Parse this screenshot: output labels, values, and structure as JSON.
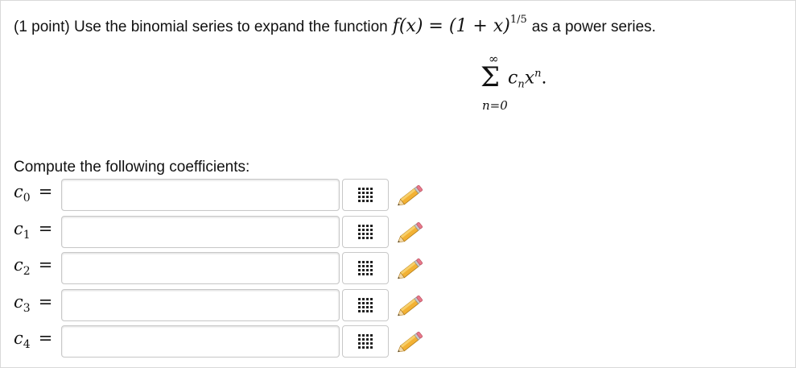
{
  "problem": {
    "points": "(1 point)",
    "text_before": "Use the binomial series to expand the function",
    "formula_lhs": "f(x) = (1 + x)",
    "formula_exponent": "1/5",
    "text_after": "as a power series.",
    "sum_top": "∞",
    "sum_term_c": "c",
    "sum_term_sub": "n",
    "sum_term_x": "x",
    "sum_term_sup": "n",
    "sum_term_end": ".",
    "sum_bottom": "n=0"
  },
  "compute_label": "Compute the following coefficients:",
  "coefficients": [
    {
      "symbol": "c",
      "index": "0",
      "eq": "=",
      "value": ""
    },
    {
      "symbol": "c",
      "index": "1",
      "eq": "=",
      "value": ""
    },
    {
      "symbol": "c",
      "index": "2",
      "eq": "=",
      "value": ""
    },
    {
      "symbol": "c",
      "index": "3",
      "eq": "=",
      "value": ""
    },
    {
      "symbol": "c",
      "index": "4",
      "eq": "=",
      "value": ""
    }
  ],
  "icons": {
    "matrix": "grid-icon",
    "edit": "pencil-icon"
  }
}
